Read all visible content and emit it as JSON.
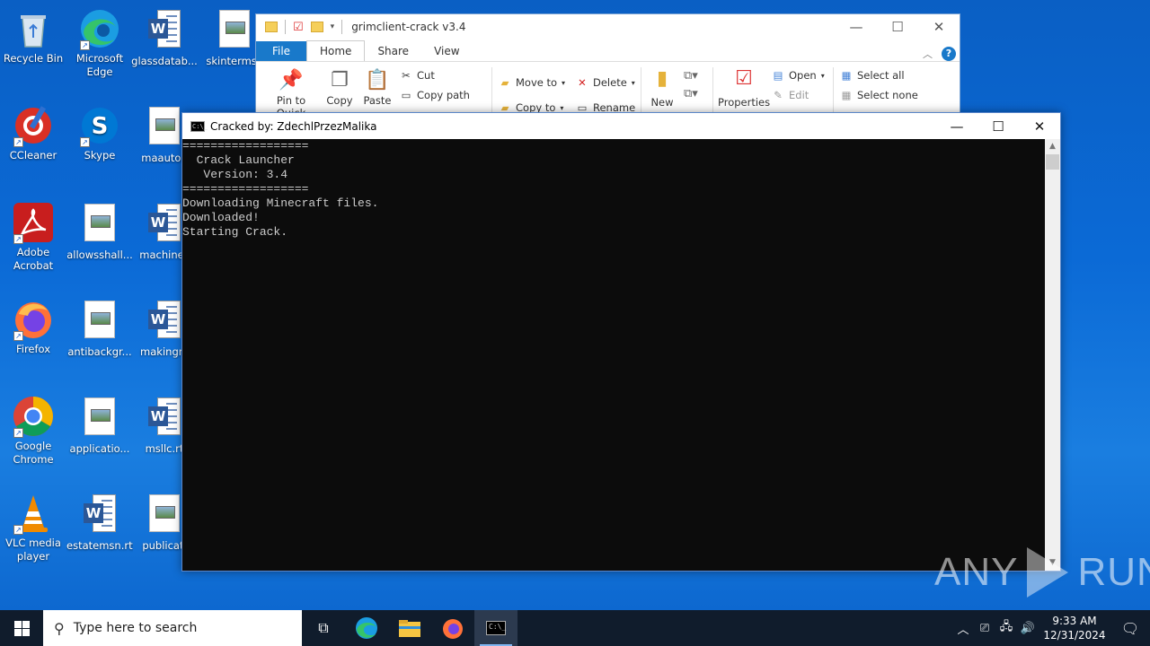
{
  "desktop": {
    "icons": [
      {
        "label": "Recycle Bin"
      },
      {
        "label": "Microsoft Edge"
      },
      {
        "label": "glassdatab..."
      },
      {
        "label": "skinterms.j"
      },
      {
        "label": "CCleaner"
      },
      {
        "label": "Skype"
      },
      {
        "label": "maauton"
      },
      {
        "label": "Adobe Acrobat"
      },
      {
        "label": "allowsshall..."
      },
      {
        "label": "machines"
      },
      {
        "label": "Firefox"
      },
      {
        "label": "antibackgr..."
      },
      {
        "label": "makingm"
      },
      {
        "label": "Google Chrome"
      },
      {
        "label": "applicatio..."
      },
      {
        "label": "msllc.rt"
      },
      {
        "label": "VLC media player"
      },
      {
        "label": "estatemsn.rtf"
      },
      {
        "label": "publicati"
      }
    ]
  },
  "explorer": {
    "title": "grimclient-crack v3.4",
    "tabs": [
      "File",
      "Home",
      "Share",
      "View"
    ],
    "ribbon": {
      "pin": "Pin to Quick",
      "copy": "Copy",
      "paste": "Paste",
      "cut": "Cut",
      "copy_path": "Copy path",
      "move_to": "Move to",
      "copy_to": "Copy to",
      "delete": "Delete",
      "rename": "Rename",
      "new": "New",
      "properties": "Properties",
      "open": "Open",
      "edit": "Edit",
      "select_all": "Select all",
      "select_none": "Select none"
    }
  },
  "console": {
    "title": "Cracked by: ZdechlPrzezMalika",
    "lines": [
      "==================",
      "  Crack Launcher",
      "   Version: 3.4",
      "==================",
      "Downloading Minecraft files.",
      "Downloaded!",
      "Starting Crack."
    ]
  },
  "watermark": {
    "left": "ANY",
    "right": "RUN"
  },
  "taskbar": {
    "search_placeholder": "Type here to search",
    "time": "9:33 AM",
    "date": "12/31/2024"
  }
}
